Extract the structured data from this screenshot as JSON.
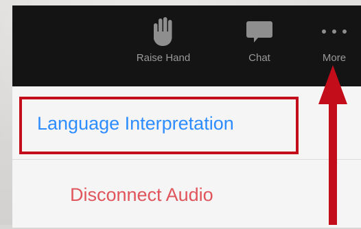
{
  "toolbar": {
    "raise_hand": {
      "label": "Raise Hand",
      "icon": "hand-icon"
    },
    "chat": {
      "label": "Chat",
      "icon": "chat-bubble-icon"
    },
    "more": {
      "label": "More",
      "icon": "more-dots-icon"
    }
  },
  "menu": {
    "items": [
      {
        "label": "Language Interpretation",
        "color": "#2d8cff"
      },
      {
        "label": "Disconnect Audio",
        "color": "#e0555b"
      }
    ]
  },
  "annotation": {
    "highlight_color": "#c30d1a",
    "arrow_color": "#c30d1a",
    "arrow_icon": "up-arrow-icon"
  }
}
